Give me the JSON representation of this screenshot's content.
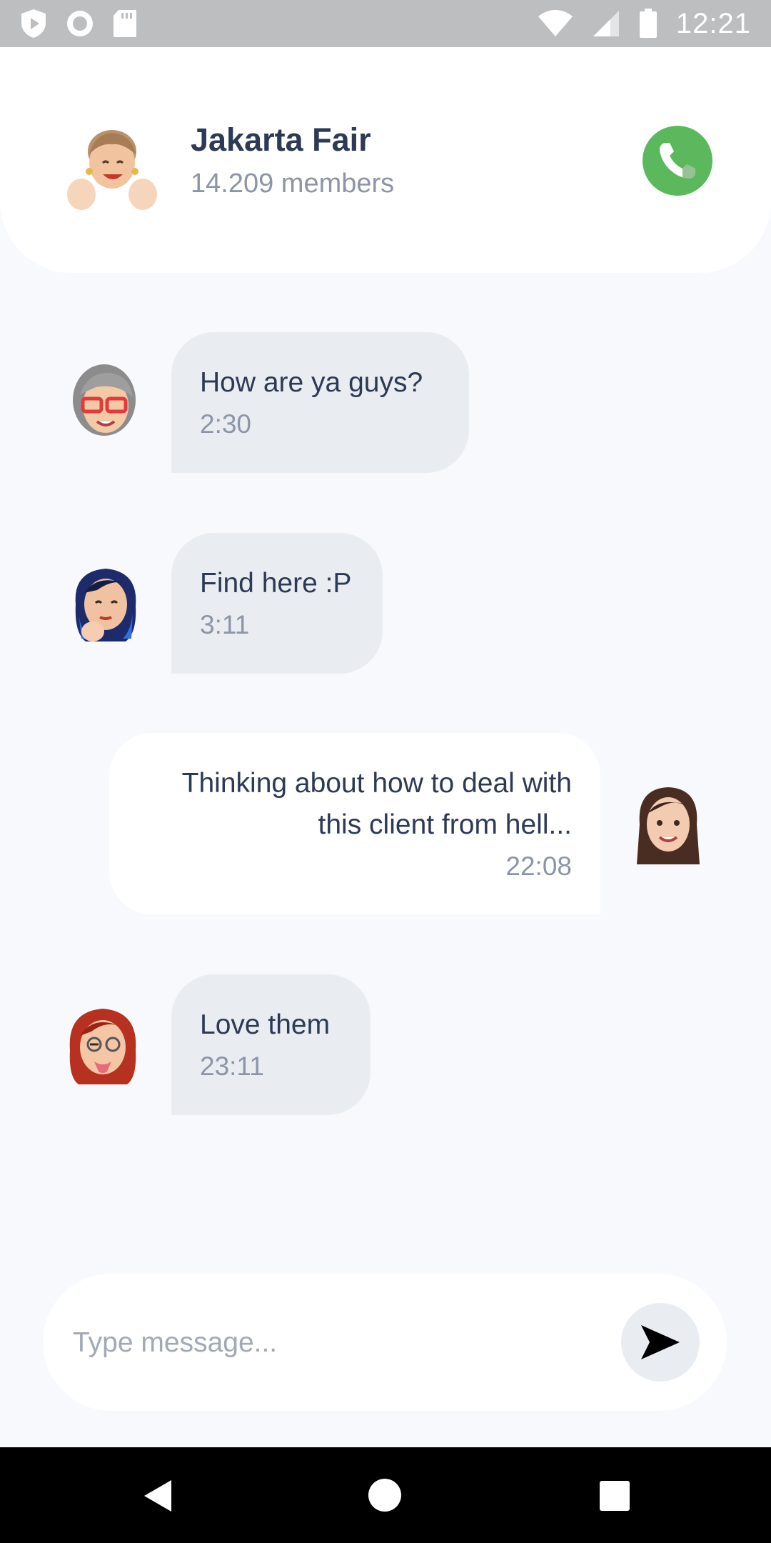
{
  "status_bar": {
    "time": "12:21",
    "left_icons": [
      "shield-play-icon",
      "circle-record-icon",
      "sd-card-icon"
    ],
    "right_icons": [
      "wifi-icon",
      "signal-icon",
      "battery-icon"
    ]
  },
  "header": {
    "group_name": "Jakarta Fair",
    "members": "14.209 members",
    "call_icon": "phone-icon",
    "call_color": "#5cb85c"
  },
  "messages": [
    {
      "direction": "in",
      "text": "How are ya guys?",
      "time": "2:30",
      "avatar": "memoji-grey-hair-glasses"
    },
    {
      "direction": "in",
      "text": "Find here :P",
      "time": "3:11",
      "avatar": "memoji-blue-hair-thinking"
    },
    {
      "direction": "out",
      "text_line1": "Thinking about how to deal with",
      "text_line2": "this client from hell...",
      "time": "22:08",
      "avatar": "memoji-brown-hair"
    },
    {
      "direction": "in",
      "text": "Love them",
      "time": "23:11",
      "avatar": "memoji-red-hair-wink"
    }
  ],
  "composer": {
    "placeholder": "Type message...",
    "send_icon": "send-arrow-icon"
  },
  "nav_bar": {
    "icons": [
      "back-icon",
      "home-icon",
      "recents-icon"
    ]
  }
}
